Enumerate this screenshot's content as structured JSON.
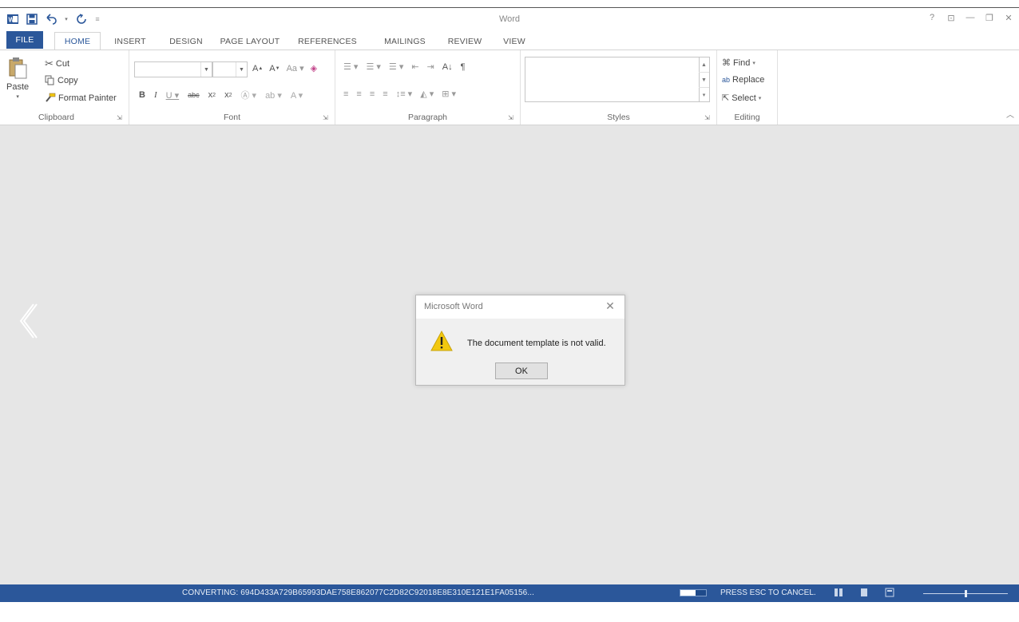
{
  "window": {
    "title": "Word",
    "controls": {
      "help": "?",
      "ribbon_options": "⊡",
      "minimize": "—",
      "restore": "❐",
      "close": "✕"
    }
  },
  "tabs": [
    {
      "label": "FILE",
      "kind": "file"
    },
    {
      "label": "HOME",
      "kind": "active"
    },
    {
      "label": "INSERT"
    },
    {
      "label": "DESIGN"
    },
    {
      "label": "PAGE LAYOUT"
    },
    {
      "label": "REFERENCES"
    },
    {
      "label": "MAILINGS"
    },
    {
      "label": "REVIEW"
    },
    {
      "label": "VIEW"
    }
  ],
  "ribbon": {
    "clipboard": {
      "label": "Clipboard",
      "paste": "Paste",
      "cut": "Cut",
      "copy": "Copy",
      "format_painter": "Format Painter"
    },
    "font": {
      "label": "Font",
      "font_name_value": "",
      "font_size_value": ""
    },
    "paragraph": {
      "label": "Paragraph"
    },
    "styles": {
      "label": "Styles"
    },
    "editing": {
      "label": "Editing",
      "find": "Find",
      "replace": "Replace",
      "select": "Select"
    }
  },
  "dialog": {
    "title": "Microsoft Word",
    "message": "The document template is not valid.",
    "ok_label": "OK"
  },
  "status": {
    "converting": "CONVERTING: 694D433A729B65993DAE758E862077C2D82C92018E8E310E121E1FA05156...",
    "progress_fraction": 0.6,
    "esc_text": "PRESS ESC TO CANCEL.",
    "zoom_fraction": 0.5
  },
  "colors": {
    "accent": "#2b579a",
    "doc_background": "#e6e6e6",
    "warning": "#f2c80f"
  }
}
